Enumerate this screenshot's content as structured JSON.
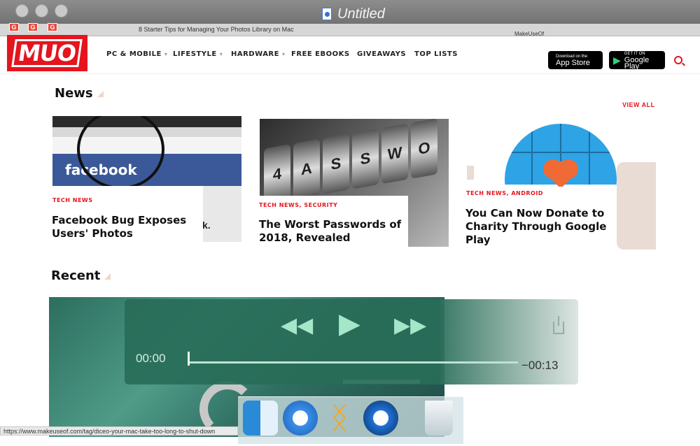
{
  "window": {
    "title": "Untitled"
  },
  "tabs": [
    {
      "label": "8 Starter Tips for Managing Your Photos Library on Mac"
    },
    {
      "label": "MakeUseOf"
    }
  ],
  "site": {
    "logo_text": "MUO",
    "nav": [
      "PC & MOBILE",
      "LIFESTYLE",
      "HARDWARE",
      "FREE EBOOKS",
      "GIVEAWAYS",
      "TOP LISTS"
    ],
    "appstore": {
      "small": "Download on the",
      "big": "App Store"
    },
    "googleplay": {
      "small": "GET IT ON",
      "big": "Google Play"
    }
  },
  "news": {
    "heading": "News",
    "view_all": "VIEW ALL",
    "cards": [
      {
        "category": "TECH NEWS",
        "title_line1": "Facebook Bug Exposes",
        "title_line2": "Users' Photos",
        "image_text": "facebook"
      },
      {
        "category": "TECH NEWS, SECURITY",
        "title_line1": "The Worst Passwords of",
        "title_line2": "2018, Revealed"
      },
      {
        "category": "TECH NEWS, ANDROID",
        "title_line1": "You Can Now Donate to",
        "title_line2": "Charity Through Google",
        "title_line3": "Play"
      }
    ]
  },
  "recent": {
    "heading": "Recent"
  },
  "player": {
    "elapsed": "00:00",
    "remaining": "−00:13",
    "progress": 0.0
  },
  "status_url": "https://www.makeuseof.com/tag/diceo-your-mac-take-too-long-to-shut-down",
  "colors": {
    "brand": "#e5141d",
    "player": "#286c58"
  }
}
